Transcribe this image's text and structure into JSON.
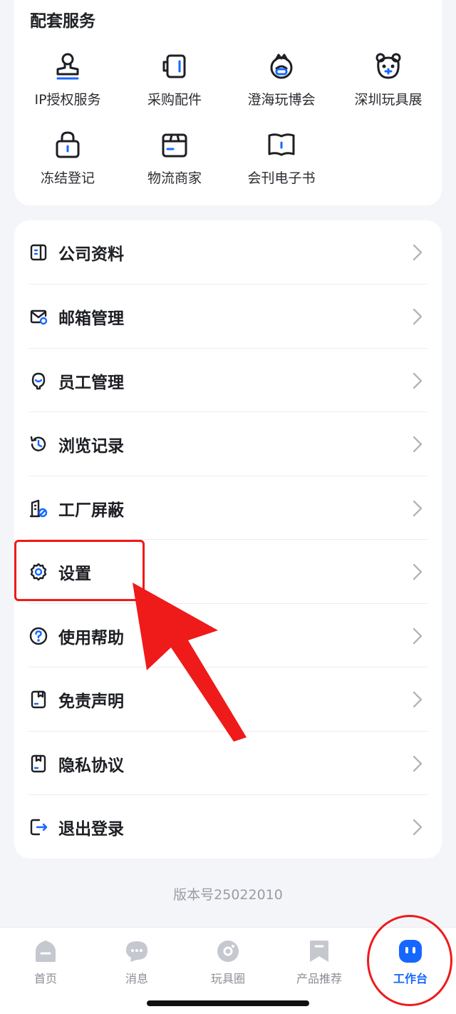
{
  "services": {
    "title": "配套服务",
    "items": [
      {
        "label": "IP授权服务",
        "icon": "stamp-icon"
      },
      {
        "label": "采购配件",
        "icon": "battery-icon"
      },
      {
        "label": "澄海玩博会",
        "icon": "expo-icon"
      },
      {
        "label": "深圳玩具展",
        "icon": "bear-icon"
      },
      {
        "label": "冻结登记",
        "icon": "lock-icon"
      },
      {
        "label": "物流商家",
        "icon": "truck-box-icon"
      },
      {
        "label": "会刊电子书",
        "icon": "book-icon"
      }
    ]
  },
  "menu": {
    "items": [
      {
        "label": "公司资料",
        "icon": "company-profile-icon"
      },
      {
        "label": "邮箱管理",
        "icon": "mailbox-icon"
      },
      {
        "label": "员工管理",
        "icon": "staff-icon"
      },
      {
        "label": "浏览记录",
        "icon": "history-icon"
      },
      {
        "label": "工厂屏蔽",
        "icon": "factory-block-icon"
      },
      {
        "label": "设置",
        "icon": "gear-icon"
      },
      {
        "label": "使用帮助",
        "icon": "help-icon"
      },
      {
        "label": "免责声明",
        "icon": "disclaimer-icon"
      },
      {
        "label": "隐私协议",
        "icon": "privacy-icon"
      },
      {
        "label": "退出登录",
        "icon": "logout-icon"
      }
    ]
  },
  "version_text": "版本号25022010",
  "tabbar": {
    "tabs": [
      {
        "label": "首页",
        "icon": "home-icon",
        "active": false
      },
      {
        "label": "消息",
        "icon": "message-icon",
        "active": false
      },
      {
        "label": "玩具圈",
        "icon": "toy-circle-icon",
        "active": false
      },
      {
        "label": "产品推荐",
        "icon": "bookmark-icon",
        "active": false
      },
      {
        "label": "工作台",
        "icon": "workbench-icon",
        "active": true
      }
    ]
  },
  "colors": {
    "accent": "#1667ff",
    "annotation_red": "#ef1a1a",
    "tab_inactive": "#c5c8cf"
  }
}
